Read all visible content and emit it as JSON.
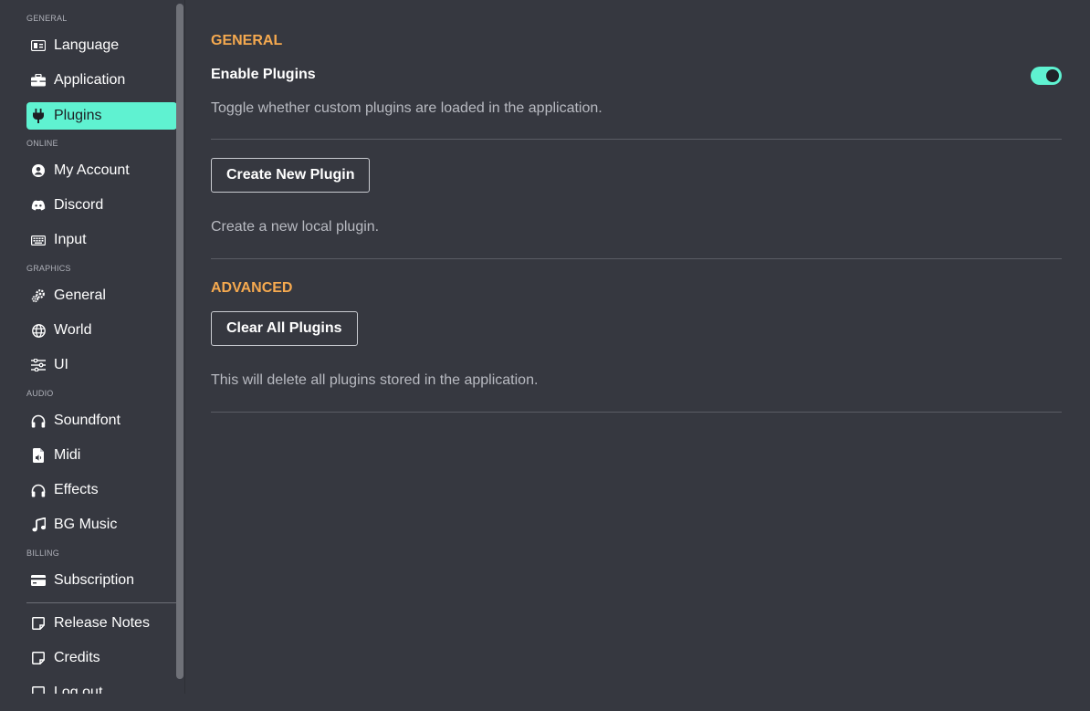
{
  "sidebar": {
    "sections": {
      "general": "GENERAL",
      "online": "ONLINE",
      "graphics": "GRAPHICS",
      "audio": "AUDIO",
      "billing": "BILLING"
    },
    "items": {
      "language": "Language",
      "application": "Application",
      "plugins": "Plugins",
      "my_account": "My Account",
      "discord": "Discord",
      "input": "Input",
      "graphics_general": "General",
      "world": "World",
      "ui": "UI",
      "soundfont": "Soundfont",
      "midi": "Midi",
      "effects": "Effects",
      "bg_music": "BG Music",
      "subscription": "Subscription",
      "release_notes": "Release Notes",
      "credits": "Credits",
      "log_out": "Log out"
    },
    "active_item": "plugins"
  },
  "main": {
    "general_title": "GENERAL",
    "enable_plugins_label": "Enable Plugins",
    "enable_plugins_on": true,
    "enable_plugins_desc": "Toggle whether custom plugins are loaded in the application.",
    "create_button": "Create New Plugin",
    "create_desc": "Create a new local plugin.",
    "advanced_title": "ADVANCED",
    "clear_button": "Clear All Plugins",
    "clear_desc": "This will delete all plugins stored in the application."
  },
  "colors": {
    "background": "#363840",
    "accent": "#5ff2d1",
    "section_heading": "#f5a94f"
  }
}
